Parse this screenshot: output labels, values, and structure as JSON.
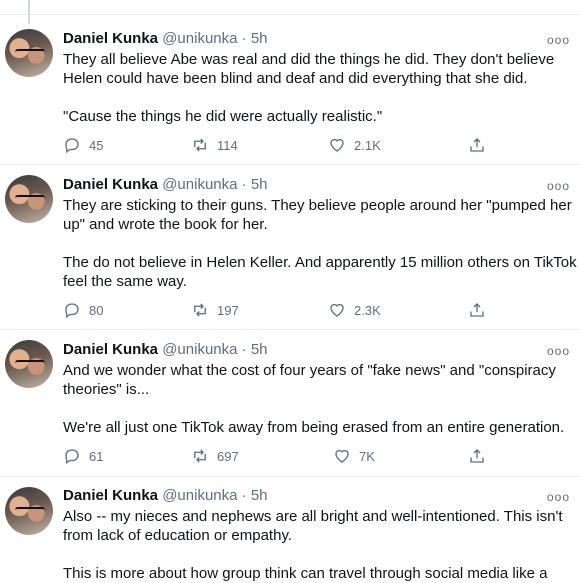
{
  "tweets": [
    {
      "name": "Daniel Kunka",
      "handle": "@unikunka",
      "separator": "·",
      "time": "5h",
      "more": "ooo",
      "paragraphs": [
        "They all believe Abe was real and did the things he did.  They don't believe Helen could have been blind and deaf and did everything that she did.",
        "\"Cause the things he did were actually realistic.\""
      ],
      "replies": "45",
      "retweets": "114",
      "likes": "2.1K"
    },
    {
      "name": "Daniel Kunka",
      "handle": "@unikunka",
      "separator": "·",
      "time": "5h",
      "more": "ooo",
      "paragraphs": [
        "They are sticking to their guns.  They believe people around her \"pumped her up\" and wrote the book for her.",
        "The do not believe in Helen Keller.  And apparently 15 million others on TikTok feel the same way."
      ],
      "replies": "80",
      "retweets": "197",
      "likes": "2.3K"
    },
    {
      "name": "Daniel Kunka",
      "handle": "@unikunka",
      "separator": "·",
      "time": "5h",
      "more": "ooo",
      "paragraphs": [
        "And we wonder what the cost of four years of \"fake news\" and \"conspiracy theories\" is...",
        "We're all just one TikTok away from being erased from an entire generation."
      ],
      "replies": "61",
      "retweets": "697",
      "likes": "7K"
    },
    {
      "name": "Daniel Kunka",
      "handle": "@unikunka",
      "separator": "·",
      "time": "5h",
      "more": "ooo",
      "paragraphs": [
        "Also -- my nieces and nephews are all bright and well-intentioned.  This isn't from lack of education or empathy.",
        "This is more about how group think can travel through social media like a"
      ],
      "replies": "",
      "retweets": "",
      "likes": ""
    }
  ],
  "icons": {
    "reply": "reply-icon",
    "retweet": "retweet-icon",
    "like": "heart-icon",
    "share": "share-icon"
  },
  "colors": {
    "text": "#0f1419",
    "secondary": "#5b7083",
    "divider": "#e6ecf0"
  }
}
